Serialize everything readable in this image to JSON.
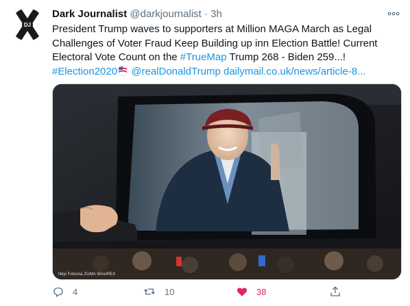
{
  "tweet": {
    "author_name": "Dark Journalist",
    "author_handle": "@darkjournalist",
    "separator": "·",
    "time": "3h",
    "avatar_text": "DJ",
    "text_part1": "President Trump waves to supporters at Million MAGA March as Legal Challenges of Voter Fraud Keep Building up inn Election Battle! Current Electoral Vote Count on the ",
    "hashtag_truemap": "#TrueMap",
    "text_part2": " Trump 268 - Biden 259...!",
    "hashtag_election": "#Election2020",
    "mention": "@realDonaldTrump",
    "link": "dailymail.co.uk/news/article-8...",
    "photo_credit": "Nliyi Foto/via ZUMA Wire/REX",
    "replies": "4",
    "retweets": "10",
    "likes": "38"
  },
  "colors": {
    "link": "#1b95e0",
    "secondary": "#5b7083",
    "like": "#e0245e"
  },
  "icons": {
    "more": "more-icon",
    "reply": "reply-icon",
    "retweet": "retweet-icon",
    "like": "heart-icon",
    "share": "share-icon",
    "flag": "us-flag-icon"
  }
}
